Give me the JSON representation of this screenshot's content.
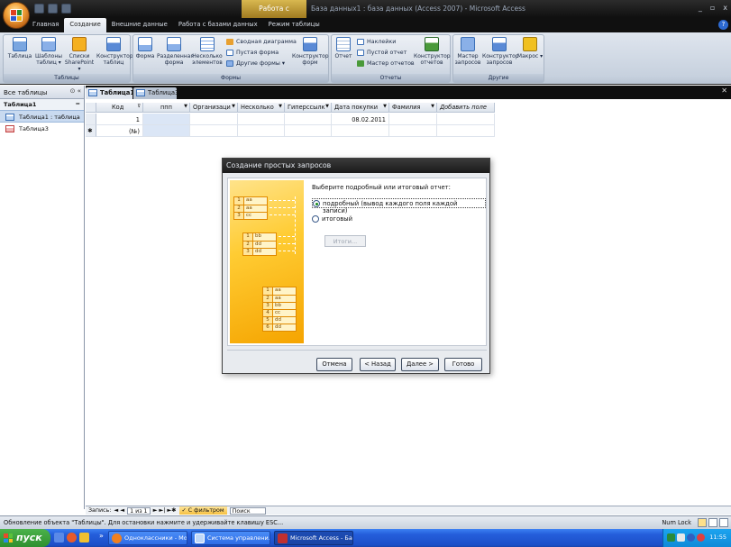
{
  "window": {
    "title": "База данных1 : база данных (Access 2007) - Microsoft Access",
    "context_tab": "Работа с таблицами",
    "controls": [
      "_",
      "▫",
      "x"
    ]
  },
  "ribbon": {
    "tabs": [
      {
        "label": "Главная"
      },
      {
        "label": "Создание",
        "active": true
      },
      {
        "label": "Внешние данные"
      },
      {
        "label": "Работа с базами данных"
      },
      {
        "label": "Режим таблицы"
      }
    ],
    "groups": {
      "tables": {
        "label": "Таблицы",
        "buttons": [
          "Таблица",
          "Шаблоны таблиц ▾",
          "Списки SharePoint ▾",
          "Конструктор таблиц"
        ]
      },
      "forms": {
        "label": "Формы",
        "buttons": [
          "Форма",
          "Разделенная форма",
          "Несколько элементов"
        ],
        "small": [
          "Сводная диаграмма",
          "Пустая форма",
          "Другие формы ▾"
        ],
        "designer": "Конструктор форм"
      },
      "reports": {
        "label": "Отчеты",
        "report": "Отчет",
        "small": [
          "Наклейки",
          "Пустой отчет",
          "Мастер отчетов"
        ],
        "designer": "Конструктор отчетов"
      },
      "other": {
        "label": "Другие",
        "buttons": [
          "Мастер запросов",
          "Конструктор запросов",
          "Макрос ▾"
        ]
      }
    }
  },
  "nav": {
    "header": "Все таблицы",
    "header_controls": "⊙ «",
    "group": "Таблица1",
    "group_chevron": "≈",
    "items": [
      "Таблица1 : таблица",
      "Таблица3"
    ]
  },
  "doc_tabs": [
    "Таблица1",
    "Таблица3"
  ],
  "table": {
    "columns": [
      "Код",
      "ппп",
      "Организаци",
      "Несколько",
      "Гиперссылк",
      "Дата покупки",
      "Фамилия",
      "Добавить поле"
    ],
    "rows": [
      [
        "1",
        "",
        "",
        "",
        "",
        "08.02.2011",
        "",
        ""
      ],
      [
        "(№)",
        "",
        "",
        "",
        "",
        "",
        "",
        ""
      ]
    ],
    "new_row_marker": "✱"
  },
  "record_nav": {
    "label": "Запись:",
    "nav_left": "◄ ◄",
    "position": "1 из 1",
    "nav_right": "► ►| ►✱",
    "filter": "С фильтром",
    "search": "Поиск"
  },
  "status": {
    "message": "Обновление объекта \"Таблицы\". Для остановки нажмите и удерживайте клавишу ESC...",
    "numlock": "Num Lock"
  },
  "dialog": {
    "title": "Создание простых запросов",
    "prompt": "Выберите подробный или итоговый отчет:",
    "options": [
      {
        "label": "подробный (вывод каждого поля каждой записи)",
        "checked": true
      },
      {
        "label": "итоговый",
        "checked": false
      }
    ],
    "itogi_label": "Итоги...",
    "buttons": [
      "Отмена",
      "< Назад",
      "Далее >",
      "Готово"
    ],
    "illustration": {
      "table_a": [
        [
          "1",
          "aa"
        ],
        [
          "2",
          "aa"
        ],
        [
          "3",
          "cc"
        ]
      ],
      "table_b": [
        [
          "1",
          "bb"
        ],
        [
          "2",
          "dd"
        ],
        [
          "3",
          "dd"
        ]
      ],
      "table_c": [
        [
          "1",
          "aa"
        ],
        [
          "2",
          "aa"
        ],
        [
          "3",
          "bb"
        ],
        [
          "4",
          "cc"
        ],
        [
          "5",
          "dd"
        ],
        [
          "6",
          "dd"
        ]
      ]
    }
  },
  "taskbar": {
    "start": "пуск",
    "tasks": [
      "Одноклассники - Мо...",
      "Система управлени...",
      "Microsoft Access - Ба..."
    ],
    "tasks_overflow": "»",
    "clock": "11:55"
  },
  "colors": {
    "ribbon_bg": "#c7d1de",
    "title_bg": "#0f0f0f",
    "taskbar": "#245edb",
    "start": "#2f8f2f",
    "illustration": "#ffcc33"
  }
}
